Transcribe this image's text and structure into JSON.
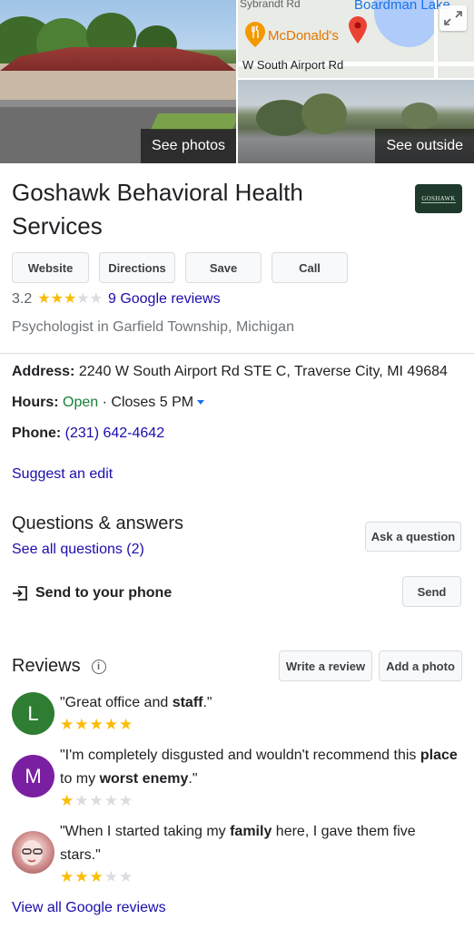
{
  "photos": {
    "see_photos_label": "See photos",
    "see_outside_label": "See outside"
  },
  "map": {
    "street_top_left": "Sybrandt Rd",
    "lake_label": "Boardman Lake",
    "poi_label": "McDonald's",
    "road_label": "W South Airport Rd"
  },
  "business": {
    "name": "Goshawk Behavioral Health Services",
    "logo_text": "GOSHAWK",
    "rating": "3.2",
    "rating_value": 3.2,
    "reviews_link": "9 Google reviews",
    "category": "Psychologist in Garfield Township, Michigan"
  },
  "actions": {
    "website": "Website",
    "directions": "Directions",
    "save": "Save",
    "call": "Call"
  },
  "details": {
    "address_label": "Address:",
    "address_value": "2240 W South Airport Rd STE C, Traverse City, MI 49684",
    "hours_label": "Hours:",
    "hours_status": "Open",
    "hours_separator": "·",
    "hours_closes": "Closes 5 PM",
    "phone_label": "Phone:",
    "phone_value": "(231) 642-4642",
    "suggest_edit": "Suggest an edit"
  },
  "qa": {
    "title": "Questions & answers",
    "see_all": "See all questions (2)",
    "ask_button": "Ask a question"
  },
  "send": {
    "label": "Send to your phone",
    "button": "Send"
  },
  "reviews": {
    "title": "Reviews",
    "write_button": "Write a review",
    "photo_button": "Add a photo",
    "view_all": "View all Google reviews",
    "items": [
      {
        "initial": "L",
        "avatar_color": "#2e7d32",
        "stars": 5,
        "text_parts": [
          "\"Great office and ",
          "staff",
          ".\""
        ]
      },
      {
        "initial": "M",
        "avatar_color": "#7b1fa2",
        "stars": 1,
        "text_parts": [
          "\"I'm completely disgusted and wouldn't recommend this ",
          "place",
          " to my ",
          "worst enemy",
          ".\""
        ]
      },
      {
        "initial": "",
        "avatar_color": "",
        "stars": 3,
        "text_parts": [
          "\"When I started taking my ",
          "family",
          " here, I gave them five stars.\""
        ]
      }
    ]
  },
  "colors": {
    "link": "#1a0dab",
    "open": "#188038",
    "star_on": "#fbbc04",
    "star_off": "#dadce0"
  }
}
